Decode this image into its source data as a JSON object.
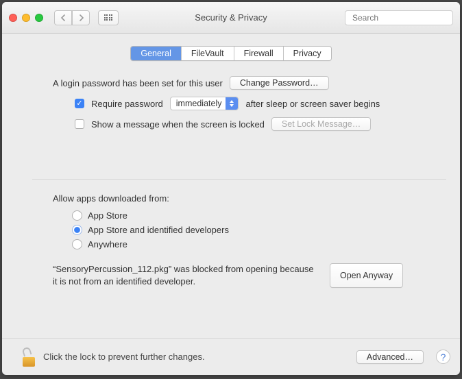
{
  "window": {
    "title": "Security & Privacy"
  },
  "search": {
    "placeholder": "Search"
  },
  "tabs": [
    {
      "label": "General",
      "active": true
    },
    {
      "label": "FileVault",
      "active": false
    },
    {
      "label": "Firewall",
      "active": false
    },
    {
      "label": "Privacy",
      "active": false
    }
  ],
  "password": {
    "intro": "A login password has been set for this user",
    "change_btn": "Change Password…",
    "require_label": "Require password",
    "require_checked": true,
    "delay_selected": "immediately",
    "after_label": "after sleep or screen saver begins",
    "show_msg_label": "Show a message when the screen is locked",
    "show_msg_checked": false,
    "set_msg_btn": "Set Lock Message…"
  },
  "download": {
    "heading": "Allow apps downloaded from:",
    "options": [
      {
        "label": "App Store",
        "selected": false
      },
      {
        "label": "App Store and identified developers",
        "selected": true
      },
      {
        "label": "Anywhere",
        "selected": false
      }
    ],
    "blocked_text": "“SensoryPercussion_112.pkg” was blocked from opening because it is not from an identified developer.",
    "open_anyway_btn": "Open Anyway"
  },
  "footer": {
    "lock_text": "Click the lock to prevent further changes.",
    "advanced_btn": "Advanced…"
  }
}
